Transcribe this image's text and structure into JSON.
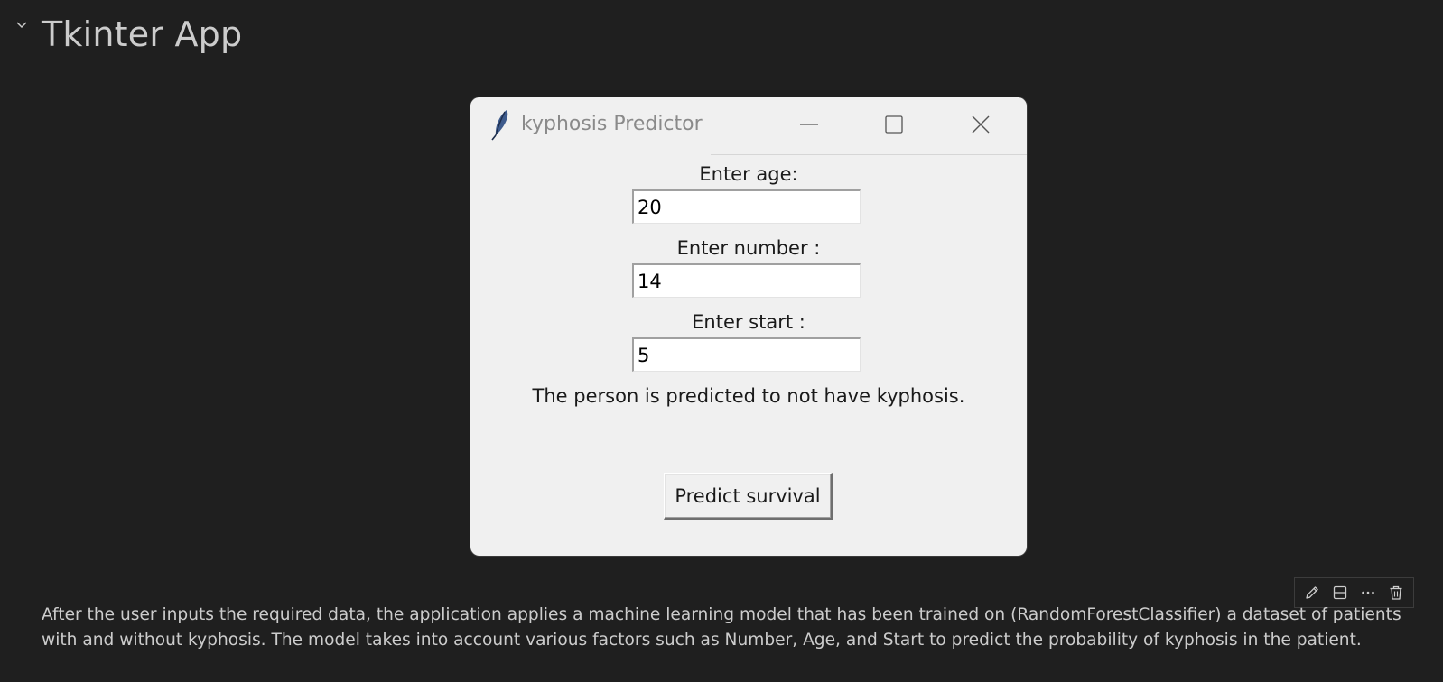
{
  "heading": {
    "title": "Tkinter App",
    "chevron_icon": "chevron-down-icon"
  },
  "window": {
    "title": "kyphosis Predictor",
    "icon": "feather-icon",
    "controls": {
      "minimize_icon": "minimize-icon",
      "maximize_icon": "maximize-icon",
      "close_icon": "close-icon"
    },
    "form": {
      "age_label": "Enter age:",
      "age_value": "20",
      "number_label": "Enter number :",
      "number_value": "14",
      "start_label": "Enter start :",
      "start_value": "5",
      "result_text": "The person is predicted to not have kyphosis.",
      "predict_button": "Predict survival"
    }
  },
  "cell_toolbar": {
    "edit_icon": "pencil-icon",
    "split_icon": "split-cell-icon",
    "more_icon": "more-actions-icon",
    "delete_icon": "trash-icon"
  },
  "description": "After the user inputs the required data, the application applies a machine learning model that has been trained on (RandomForestClassifier) a dataset of patients with and without kyphosis. The model takes into account various factors such as Number, Age, and Start to predict the probability of kyphosis in the patient.",
  "colors": {
    "background": "#1f1f1f",
    "window_background": "#f0f0f0",
    "text_light": "#cccccc"
  }
}
